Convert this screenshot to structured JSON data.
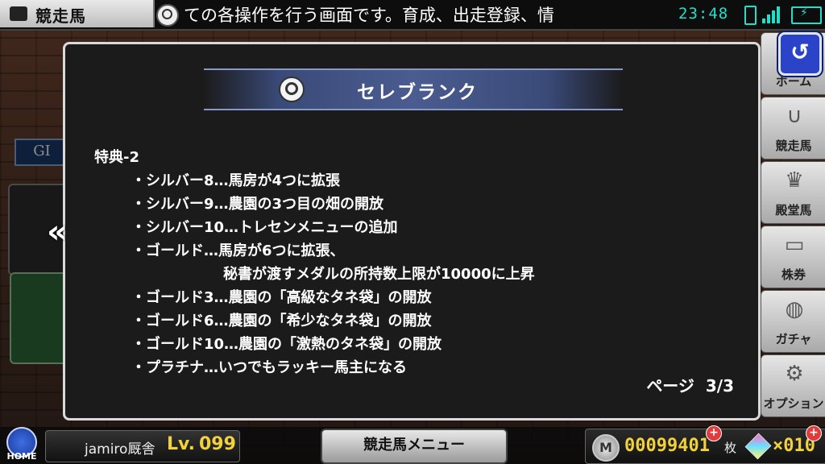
{
  "statusbar": {
    "screen_title": "競走馬",
    "ticker_text": "ての各操作を行う画面です。育成、出走登録、情",
    "clock": "23:48"
  },
  "background": {
    "gi_label": "GI"
  },
  "right_menu": {
    "items": [
      {
        "label": "ホーム",
        "icon": "home-icon"
      },
      {
        "label": "競走馬",
        "icon": "horseshoe-icon"
      },
      {
        "label": "殿堂馬",
        "icon": "crown-icon"
      },
      {
        "label": "株券",
        "icon": "certificate-icon"
      },
      {
        "label": "ガチャ",
        "icon": "gacha-icon"
      },
      {
        "label": "オプション",
        "icon": "gear-icon"
      }
    ]
  },
  "bottom_bar": {
    "home_label": "HOME",
    "player_name": "jamiro厩舎",
    "level_label": "Lv.",
    "level_value": "099",
    "menu_button": "競走馬メニュー",
    "coins": "00099401",
    "coin_unit": "枚",
    "gems": "×010"
  },
  "dialog": {
    "title": "セレブランク",
    "heading": "特典-2",
    "lines": [
      "・シルバー8…馬房が4つに拡張",
      "・シルバー9…農園の3つ目の畑の開放",
      "・シルバー10…トレセンメニューの追加",
      "・ゴールド…馬房が6つに拡張、"
    ],
    "continuation": "秘書が渡すメダルの所持数上限が10000に上昇",
    "lines_after": [
      "・ゴールド3…農園の「高級なタネ袋」の開放",
      "・ゴールド6…農園の「希少なタネ袋」の開放",
      "・ゴールド10…農園の「激熱のタネ袋」の開放",
      "・プラチナ…いつでもラッキー馬主になる"
    ],
    "page_label": "ページ",
    "page_value": "3/3",
    "prev_arrow": "«"
  },
  "colors": {
    "accent_teal": "#1fe0c8",
    "dialog_bg": "#1b1b1b",
    "header_blue": "#4a5c90",
    "gold_text": "#f2d23a",
    "back_button": "#2a43c8"
  }
}
